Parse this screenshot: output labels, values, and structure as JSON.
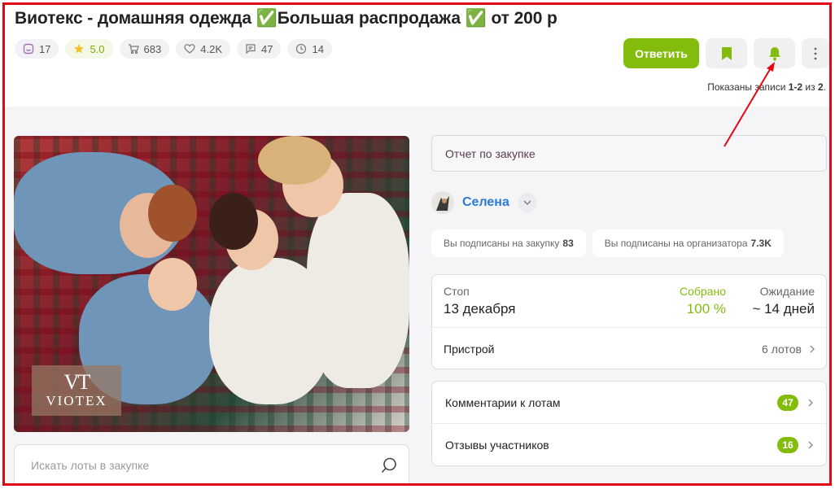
{
  "title": "Виотекс - домашняя одежда ✅Большая распродажа ✅ от 200 р",
  "stats": {
    "likes": "17",
    "rating": "5.0",
    "orders": "683",
    "favorites": "4.2K",
    "comments": "47",
    "days": "14"
  },
  "actions": {
    "reply_label": "Ответить",
    "bookmark_icon": "bookmark-icon",
    "bell_icon": "bell-icon",
    "more_icon": "more-vertical-icon"
  },
  "records": {
    "prefix": "Показаны записи ",
    "range": "1-2",
    "middle": " из ",
    "total": "2",
    "suffix": "."
  },
  "photo": {
    "logo_mark": "VT",
    "logo_text": "VIOTEX"
  },
  "search": {
    "placeholder": "Искать лоты в закупке"
  },
  "report": {
    "label": "Отчет по закупке"
  },
  "organizer": {
    "name": "Селена"
  },
  "subscriptions": {
    "purchase_label": "Вы подписаны на закупку",
    "purchase_count": "83",
    "organizer_label": "Вы подписаны на организатора",
    "organizer_count": "7.3K"
  },
  "purchase_stats": {
    "stop_label": "Стоп",
    "stop_value": "13 декабря",
    "collected_label": "Собрано",
    "collected_value": "100 %",
    "waiting_label": "Ожидание",
    "waiting_value": "~ 14 дней",
    "attach_label": "Пристрой",
    "attach_value": "6 лотов"
  },
  "links": {
    "lot_comments_label": "Комментарии к лотам",
    "lot_comments_count": "47",
    "reviews_label": "Отзывы участников",
    "reviews_count": "16"
  },
  "colors": {
    "accent": "#84bc0e",
    "link": "#2a7ad8",
    "annotation": "#e30613"
  }
}
